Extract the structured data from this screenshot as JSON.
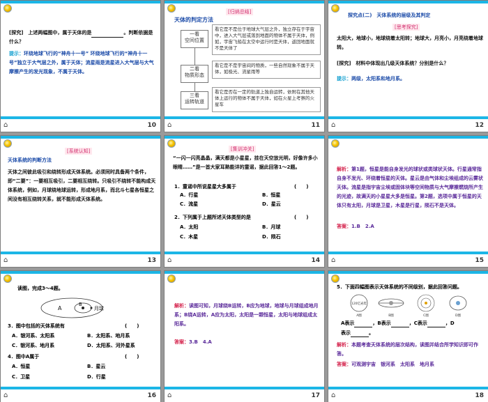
{
  "pages": {
    "p10": "10",
    "p11": "11",
    "p12": "12",
    "p13": "13",
    "p14": "14",
    "p15": "15",
    "p16": "16",
    "p17": "17",
    "p18": "18"
  },
  "home_icon": "home-icon",
  "s10": {
    "q_label": "[探究]",
    "q_text": "上述两幅图中，属于天体的是",
    "q_text2": "。判断依据是什么？",
    "tip_label": "提示：",
    "tip_text": "环绕地球飞行的“神舟十一号”  环绕地球飞行的“神舟十一号”独立于大气层之外，属于天体；流星雨是流星进入大气层与大气摩擦产生的发光现象，不属于天体。"
  },
  "s11": {
    "tag": "[归纳总结]",
    "title": "天体的判定方法",
    "steps": [
      {
        "label": "一看\n空间位置",
        "desc": "看它是不是位于地球大气层之外，独立存在于宇宙中，进入大气层或落到地面的物体不属于天体，例如，宇宙飞船在太空中运行时是天体，返回地面就不是天体了"
      },
      {
        "label": "二看\n物质形态",
        "desc": "看它是不是宇宙间的物质，一些自然现象不属于天体，如极光、流星雨等"
      },
      {
        "label": "三看\n运转轨道",
        "desc": "看它是否在一定的轨道上独自运转，依附在其他天体上运行的物体不属于天体，如在火星上考察的火星车"
      }
    ]
  },
  "s12": {
    "head": "探究点(二)　天体系统的层级及其判定",
    "tag": "[思考探究]",
    "para": "太阳大，地球小，地球绕着太阳转；地球大，月亮小，月亮绕着地球转。",
    "q_label": "[探究]",
    "q_text": "材料中体现出几级天体系统？分别是什么？",
    "tip_label": "提示：",
    "tip_text": "两级，太阳系和地月系。"
  },
  "s13": {
    "tag": "[系统认知]",
    "title": "天体系统的判断方法",
    "body": "天体之间彼此吸引和绕转形成天体系统。必须同时具备两个条件，即“二要”：一要相互吸引，二要相互绕转。只吸引不绕转不能构成天体系统，例如，月球绕地球运转，形成地月系，而北斗七星各恒星之间没有相互绕转关系，就不能形成天体系统。"
  },
  "s14": {
    "tag": "[集训冲关]",
    "intro": "“一闪一闪亮晶晶，满天都是小星星，挂在天空放光明，好像许多小眼睛……”是一首大家耳熟能详的童谣，据此回答1～2题。",
    "q1": "1．童谣中所说星星大多属于",
    "q1_paren": "(　　)",
    "q1_opts": [
      "A．行星",
      "B．恒星",
      "C．流星",
      "D．星云"
    ],
    "q2": "2．下列属于上题所述天体类型的是",
    "q2_paren": "(　　)",
    "q2_opts": [
      "A．太阳",
      "B．月球",
      "C．木星",
      "D．陨石"
    ]
  },
  "s15": {
    "label": "解析：",
    "text": "第1题，恒星是能自身发光的球状或类球状天体。行星通常指自身不发光、环绕着恒星的天体。星云是由气体和尘埃组成的云雾状天体。流星是指宇宙尘埃或固体块等空间物质与大气摩擦燃烧所产生的光迹，故满天的小星星大多是恒星。第2题，选项中属于恒星的天体只有太阳，月球是卫星，木星是行星，陨石不是天体。",
    "ans_label": "答案：",
    "ans": "1.B　2.A"
  },
  "s16": {
    "intro": "读图，完成3～4题。",
    "diagram": {
      "a": "A",
      "b": "B",
      "moon": "月球"
    },
    "q3": "3．图中包括的天体系统有",
    "q3_paren": "(　　)",
    "q3_opts": [
      "A．银河系、太阳系",
      "B．太阳系、地月系",
      "C．银河系、地月系",
      "D．太阳系、河外星系"
    ],
    "q4": "4．图中A属于",
    "q4_paren": "(　　)",
    "q4_opts": [
      "A．恒星",
      "B．星云",
      "C．卫星",
      "D．行星"
    ]
  },
  "s17": {
    "label": "解析：",
    "text": "读图可知，月球绕B运转，B应为地球，地球与月球组成地月系；B绕A运转，A应为太阳，太阳是一颗恒星，太阳与地球组成太阳系。",
    "ans_label": "答案：",
    "ans": "3.B　4.A"
  },
  "s18": {
    "q": "5．下面四幅图表示天体系统的不同级别，据此回答问题。",
    "fig_labels": [
      "A图",
      "B图",
      "C图",
      "D图"
    ],
    "fig_text": "120亿光年",
    "fill1": [
      "A表示",
      "，B表示",
      "，C表示",
      "，D"
    ],
    "fill2": "表示",
    "label": "解析：",
    "text": "本题考查天体系统的层次结构，读图并结合所学知识即可作答。",
    "ans_label": "答案：",
    "ans": "可观测宇宙　银河系　太阳系　地月系"
  }
}
